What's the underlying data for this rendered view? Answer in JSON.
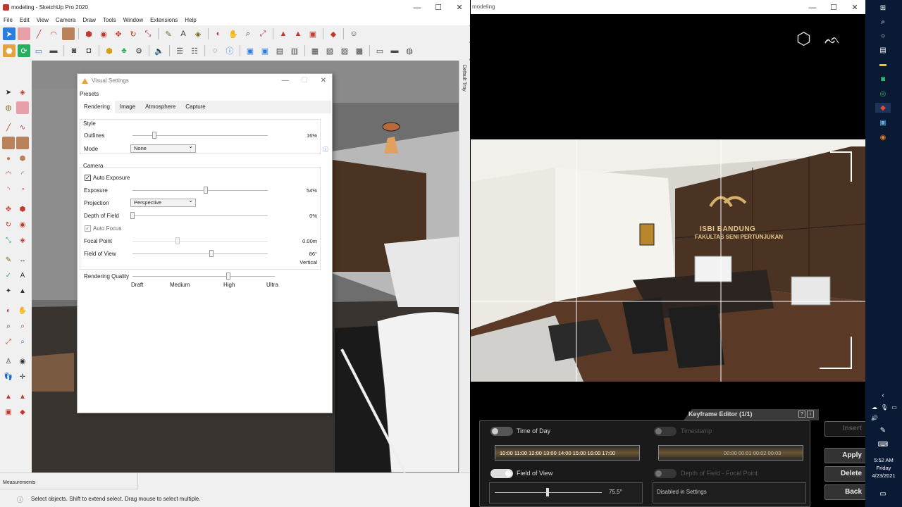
{
  "sketchup": {
    "title": "modeling - SketchUp Pro 2020",
    "menu": [
      "File",
      "Edit",
      "View",
      "Camera",
      "Draw",
      "Tools",
      "Window",
      "Extensions",
      "Help"
    ],
    "tray_label": "Default Tray",
    "measurements_label": "Measurements",
    "status_message": "Select objects. Shift to extend select. Drag mouse to select multiple."
  },
  "visual_settings": {
    "title": "Visual Settings",
    "presets_label": "Presets",
    "tabs": [
      "Rendering",
      "Image",
      "Atmosphere",
      "Capture"
    ],
    "style": {
      "heading": "Style",
      "outlines_label": "Outlines",
      "outlines_value": "16%",
      "outlines_fraction": 0.16,
      "mode_label": "Mode",
      "mode_value": "None"
    },
    "camera": {
      "heading": "Camera",
      "auto_exposure_label": "Auto Exposure",
      "auto_exposure_checked": true,
      "exposure_label": "Exposure",
      "exposure_value": "54%",
      "exposure_fraction": 0.54,
      "projection_label": "Projection",
      "projection_value": "Perspective",
      "dof_label": "Depth of Field",
      "dof_value": "0%",
      "dof_fraction": 0,
      "auto_focus_label": "Auto Focus",
      "auto_focus_checked": true,
      "focal_point_label": "Focal Point",
      "focal_point_value": "0.00m",
      "fov_label": "Field of View",
      "fov_value": "86°",
      "fov_mode": "Vertical"
    },
    "quality": {
      "label": "Rendering Quality",
      "levels": [
        "Draft",
        "Medium",
        "High",
        "Ultra"
      ],
      "selected": "High"
    }
  },
  "render_window": {
    "title": "modeling",
    "sign_line1": "ISBI BANDUNG",
    "sign_line2": "FAKULTAS SENI PERTUNJUKAN",
    "keyframe_editor": {
      "title": "Keyframe Editor (1/1)",
      "time_of_day_label": "Time of Day",
      "time_of_day_on": false,
      "time_ticks": "10:00  11:00  12:00  13:00  14:00  15:00  16:00  17:00",
      "timestamp_label": "Timestamp",
      "timestamp_ticks": "00:00  00:01  00:02  00:03",
      "fov_label": "Field of View",
      "fov_on": true,
      "fov_value": "75.5°",
      "dof_label": "Depth of Field - Focal Point",
      "dof_disabled_text": "Disabled in Settings",
      "buttons": {
        "insert": "Insert",
        "apply": "Apply",
        "delete": "Delete",
        "back": "Back"
      }
    }
  },
  "taskbar": {
    "time": "5:52 AM",
    "day": "Friday",
    "date": "4/23/2021"
  }
}
